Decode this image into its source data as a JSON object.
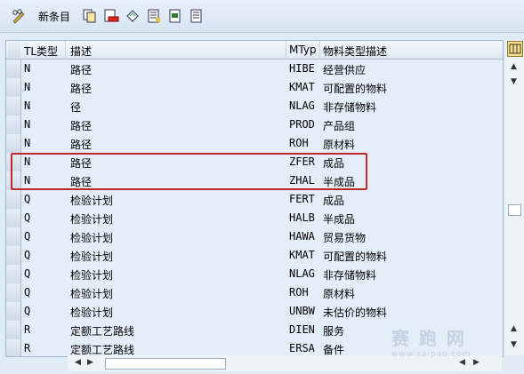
{
  "toolbar": {
    "new_entries_label": "新条目",
    "icons": [
      "pencil-glasses-icon",
      "copy-icon",
      "delete-icon",
      "undo-icon",
      "select-all-icon",
      "select-block-icon",
      "deselect-icon"
    ]
  },
  "table": {
    "columns": [
      "TL类型",
      "描述",
      "MTyp",
      "物料类型描述"
    ],
    "rows": [
      {
        "tl": "N",
        "desc": "路径",
        "mtyp": "HIBE",
        "mdesc": "经营供应"
      },
      {
        "tl": "N",
        "desc": "路径",
        "mtyp": "KMAT",
        "mdesc": "可配置的物料"
      },
      {
        "tl": "N",
        "desc": "径",
        "mtyp": "NLAG",
        "mdesc": "非存储物料"
      },
      {
        "tl": "N",
        "desc": "路径",
        "mtyp": "PROD",
        "mdesc": "产品组"
      },
      {
        "tl": "N",
        "desc": "路径",
        "mtyp": "ROH",
        "mdesc": "原材料"
      },
      {
        "tl": "N",
        "desc": "路径",
        "mtyp": "ZFER",
        "mdesc": "成品"
      },
      {
        "tl": "N",
        "desc": "路径",
        "mtyp": "ZHAL",
        "mdesc": "半成品"
      },
      {
        "tl": "Q",
        "desc": "检验计划",
        "mtyp": "FERT",
        "mdesc": "成品"
      },
      {
        "tl": "Q",
        "desc": "检验计划",
        "mtyp": "HALB",
        "mdesc": "半成品"
      },
      {
        "tl": "Q",
        "desc": "检验计划",
        "mtyp": "HAWA",
        "mdesc": "贸易货物"
      },
      {
        "tl": "Q",
        "desc": "检验计划",
        "mtyp": "KMAT",
        "mdesc": "可配置的物料"
      },
      {
        "tl": "Q",
        "desc": "检验计划",
        "mtyp": "NLAG",
        "mdesc": "非存储物料"
      },
      {
        "tl": "Q",
        "desc": "检验计划",
        "mtyp": "ROH",
        "mdesc": "原材料"
      },
      {
        "tl": "Q",
        "desc": "检验计划",
        "mtyp": "UNBW",
        "mdesc": "未估价的物料"
      },
      {
        "tl": "R",
        "desc": "定额工艺路线",
        "mtyp": "DIEN",
        "mdesc": "服务"
      },
      {
        "tl": "R",
        "desc": "定额工艺路线",
        "mtyp": "ERSA",
        "mdesc": "备件"
      }
    ]
  },
  "watermark": {
    "main": "赛 跑 网",
    "sub": "www.saipao.com"
  },
  "colors": {
    "highlight": "#c1272d",
    "row_bg": "#e4eef8",
    "toolbar_bg": "#dbe7f3"
  }
}
